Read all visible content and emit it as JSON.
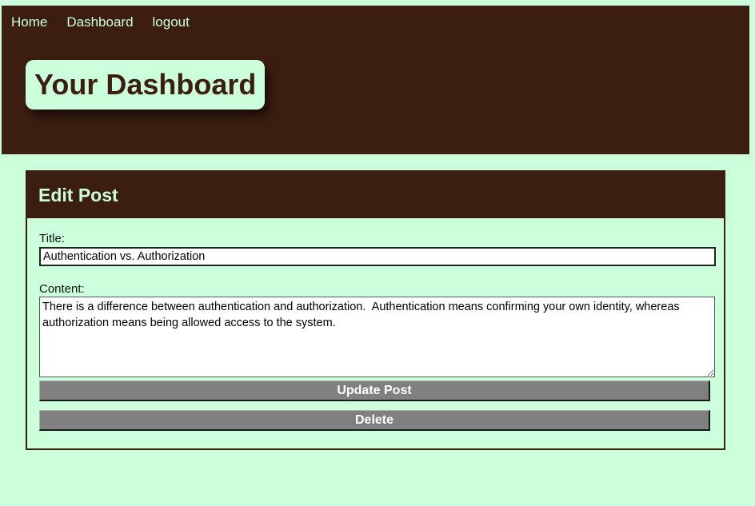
{
  "nav": {
    "home": "Home",
    "dashboard": "Dashboard",
    "logout": "logout"
  },
  "hero": {
    "title": "Your Dashboard"
  },
  "edit_post": {
    "heading": "Edit Post",
    "title_label": "Title:",
    "title_value": "Authentication vs. Authorization",
    "content_label": "Content:",
    "content_value": "There is a difference between authentication and authorization.  Authentication means confirming your own identity, whereas authorization means being allowed access to the system.",
    "update_button": "Update Post",
    "delete_button": "Delete"
  },
  "colors": {
    "background": "#ccffdc",
    "brand_dark": "#3b1e10",
    "button_gray": "#808080"
  }
}
